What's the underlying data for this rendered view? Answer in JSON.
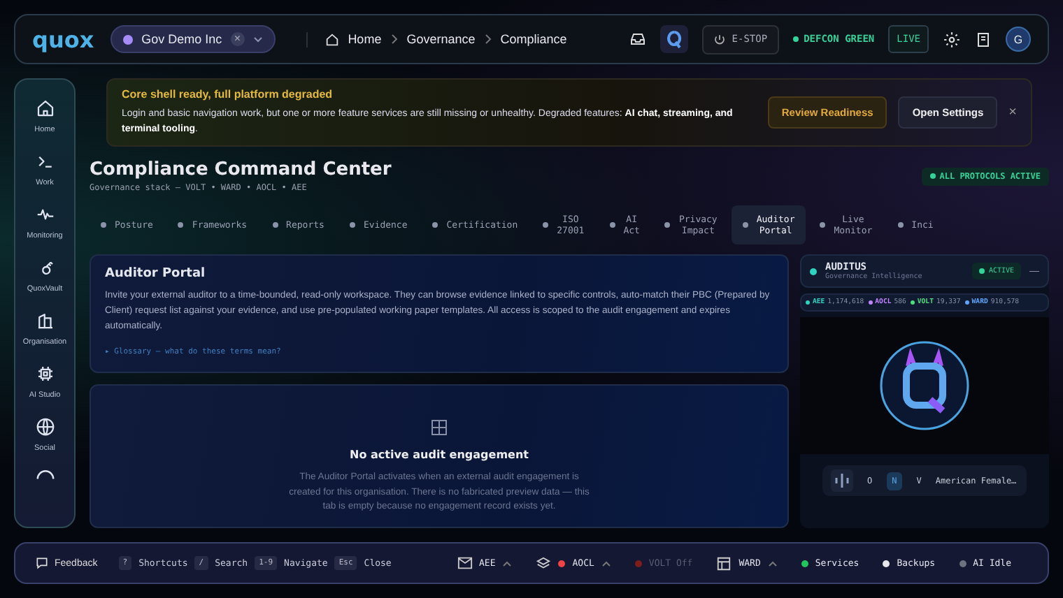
{
  "topbar": {
    "logo": "quox",
    "org": {
      "name": "Gov Demo Inc",
      "clear": "×"
    },
    "breadcrumb": [
      "Home",
      "Governance",
      "Compliance"
    ],
    "estop": "E-STOP",
    "defcon": "DEFCON GREEN",
    "live": "LIVE",
    "avatar": "G"
  },
  "sidebar": {
    "items": [
      {
        "label": "Home",
        "selected": false
      },
      {
        "label": "Work",
        "selected": false
      },
      {
        "label": "Monitoring",
        "selected": false
      },
      {
        "label": "QuoxVault",
        "selected": false
      },
      {
        "label": "Organisation",
        "selected": false
      },
      {
        "label": "AI Studio",
        "selected": false
      },
      {
        "label": "Social",
        "selected": false
      }
    ]
  },
  "banner": {
    "title": "Core shell ready, full platform degraded",
    "text": "Login and basic navigation work, but one or more feature services are still missing or unhealthy. Degraded features: **AI chat, streaming, and terminal tooling**.",
    "buttons": [
      "Review Readiness",
      "Open Settings"
    ],
    "close": "×"
  },
  "header": {
    "title": "Compliance Command Center",
    "subtitle": "Governance stack — VOLT • WARD • AOCL • AEE",
    "badge": "ALL PROTOCOLS ACTIVE"
  },
  "tabs": [
    {
      "label": "Posture",
      "selected": false
    },
    {
      "label": "Frameworks",
      "selected": false
    },
    {
      "label": "Reports",
      "selected": false
    },
    {
      "label": "Evidence",
      "selected": false
    },
    {
      "label": "Certification",
      "selected": false
    },
    {
      "label": "ISO 27001",
      "selected": false
    },
    {
      "label": "AI Act",
      "selected": false
    },
    {
      "label": "Privacy Impact",
      "selected": false
    },
    {
      "label": "Auditor Portal",
      "selected": true
    },
    {
      "label": "Live Monitor",
      "selected": false
    },
    {
      "label": "Inci",
      "selected": false
    }
  ],
  "portal": {
    "title": "Auditor Portal",
    "text": "Invite your external auditor to a time-bounded, read-only workspace. They can browse evidence linked to specific controls, auto-match their PBC (Prepared by Client) request list against your evidence, and use pre-populated working paper templates. All access is scoped to the audit engagement and expires automatically.",
    "glossary": "▸ Glossary — what do these terms mean?"
  },
  "empty": {
    "title": "No active audit engagement",
    "text": "The Auditor Portal activates when an external audit engagement is created for this organisation. There is no fabricated preview data — this tab is empty because no engagement record exists yet."
  },
  "assistant": {
    "name": "AUDITUS",
    "role": "Governance Intelligence",
    "status": "ACTIVE",
    "minimize": "—",
    "ticker": [
      {
        "label": "AEE",
        "value": "1,174,618",
        "color": "#2dd4bf"
      },
      {
        "label": "AOCL",
        "value": "586",
        "color": "#c084fc"
      },
      {
        "label": "VOLT",
        "value": "19,337",
        "color": "#4ade80"
      },
      {
        "label": "WARD",
        "value": "910,578",
        "color": "#60a5fa"
      }
    ],
    "modes": [
      {
        "label": "O",
        "selected": false
      },
      {
        "label": "N",
        "selected": true
      },
      {
        "label": "V",
        "selected": false
      }
    ],
    "voice": "American Female…"
  },
  "statusbar": {
    "feedback": "Feedback",
    "shortcuts": [
      {
        "key": "?",
        "label": "Shortcuts"
      },
      {
        "key": "/",
        "label": "Search"
      },
      {
        "key": "1-9",
        "label": "Navigate"
      },
      {
        "key": "Esc",
        "label": "Close"
      }
    ],
    "items": [
      {
        "kind": "menu",
        "label": "AEE"
      },
      {
        "kind": "menu",
        "label": "AOCL",
        "color": "#ef4444"
      },
      {
        "kind": "off",
        "label": "VOLT Off",
        "color": "#7f1d1d"
      },
      {
        "kind": "menu",
        "label": "WARD"
      },
      {
        "kind": "status",
        "label": "Services",
        "color": "#22c55e"
      },
      {
        "kind": "status",
        "label": "Backups",
        "color": "#e5e7eb"
      },
      {
        "kind": "status",
        "label": "AI Idle",
        "color": "#6b7280"
      }
    ]
  }
}
